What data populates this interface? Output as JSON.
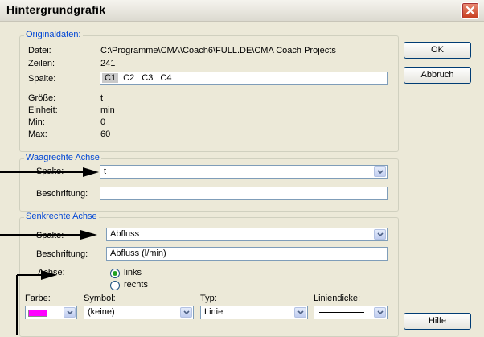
{
  "window": {
    "title": "Hintergrundgrafik"
  },
  "buttons": {
    "ok": "OK",
    "cancel": "Abbruch",
    "help": "Hilfe"
  },
  "original": {
    "legend": "Originaldaten:",
    "file_label": "Datei:",
    "file_value": "C:\\Programme\\CMA\\Coach6\\FULL.DE\\CMA Coach Projects",
    "rows_label": "Zeilen:",
    "rows_value": "241",
    "column_label": "Spalte:",
    "columns": [
      "C1",
      "C2",
      "C3",
      "C4"
    ],
    "size_label": "Größe:",
    "size_value": "t",
    "unit_label": "Einheit:",
    "unit_value": "min",
    "min_label": "Min:",
    "min_value": "0",
    "max_label": "Max:",
    "max_value": "60"
  },
  "horizontal": {
    "legend": "Waagrechte Achse",
    "column_label": "Spalte:",
    "column_value": "t",
    "caption_label": "Beschriftung:",
    "caption_value": ""
  },
  "vertical": {
    "legend": "Senkrechte Achse",
    "column_label": "Spalte:",
    "column_value": "Abfluss",
    "caption_label": "Beschriftung:",
    "caption_value": "Abfluss (l/min)",
    "axis_label": "Achse:",
    "axis_left": "links",
    "axis_right": "rechts",
    "color_label": "Farbe:",
    "color_value": "#ff00ff",
    "symbol_label": "Symbol:",
    "symbol_value": "(keine)",
    "type_label": "Typ:",
    "type_value": "Linie",
    "linewidth_label": "Liniendicke:"
  },
  "colors": {
    "legend_blue": "#0046d5",
    "close_red": "#c53a1c",
    "radio_green": "#21a121"
  }
}
